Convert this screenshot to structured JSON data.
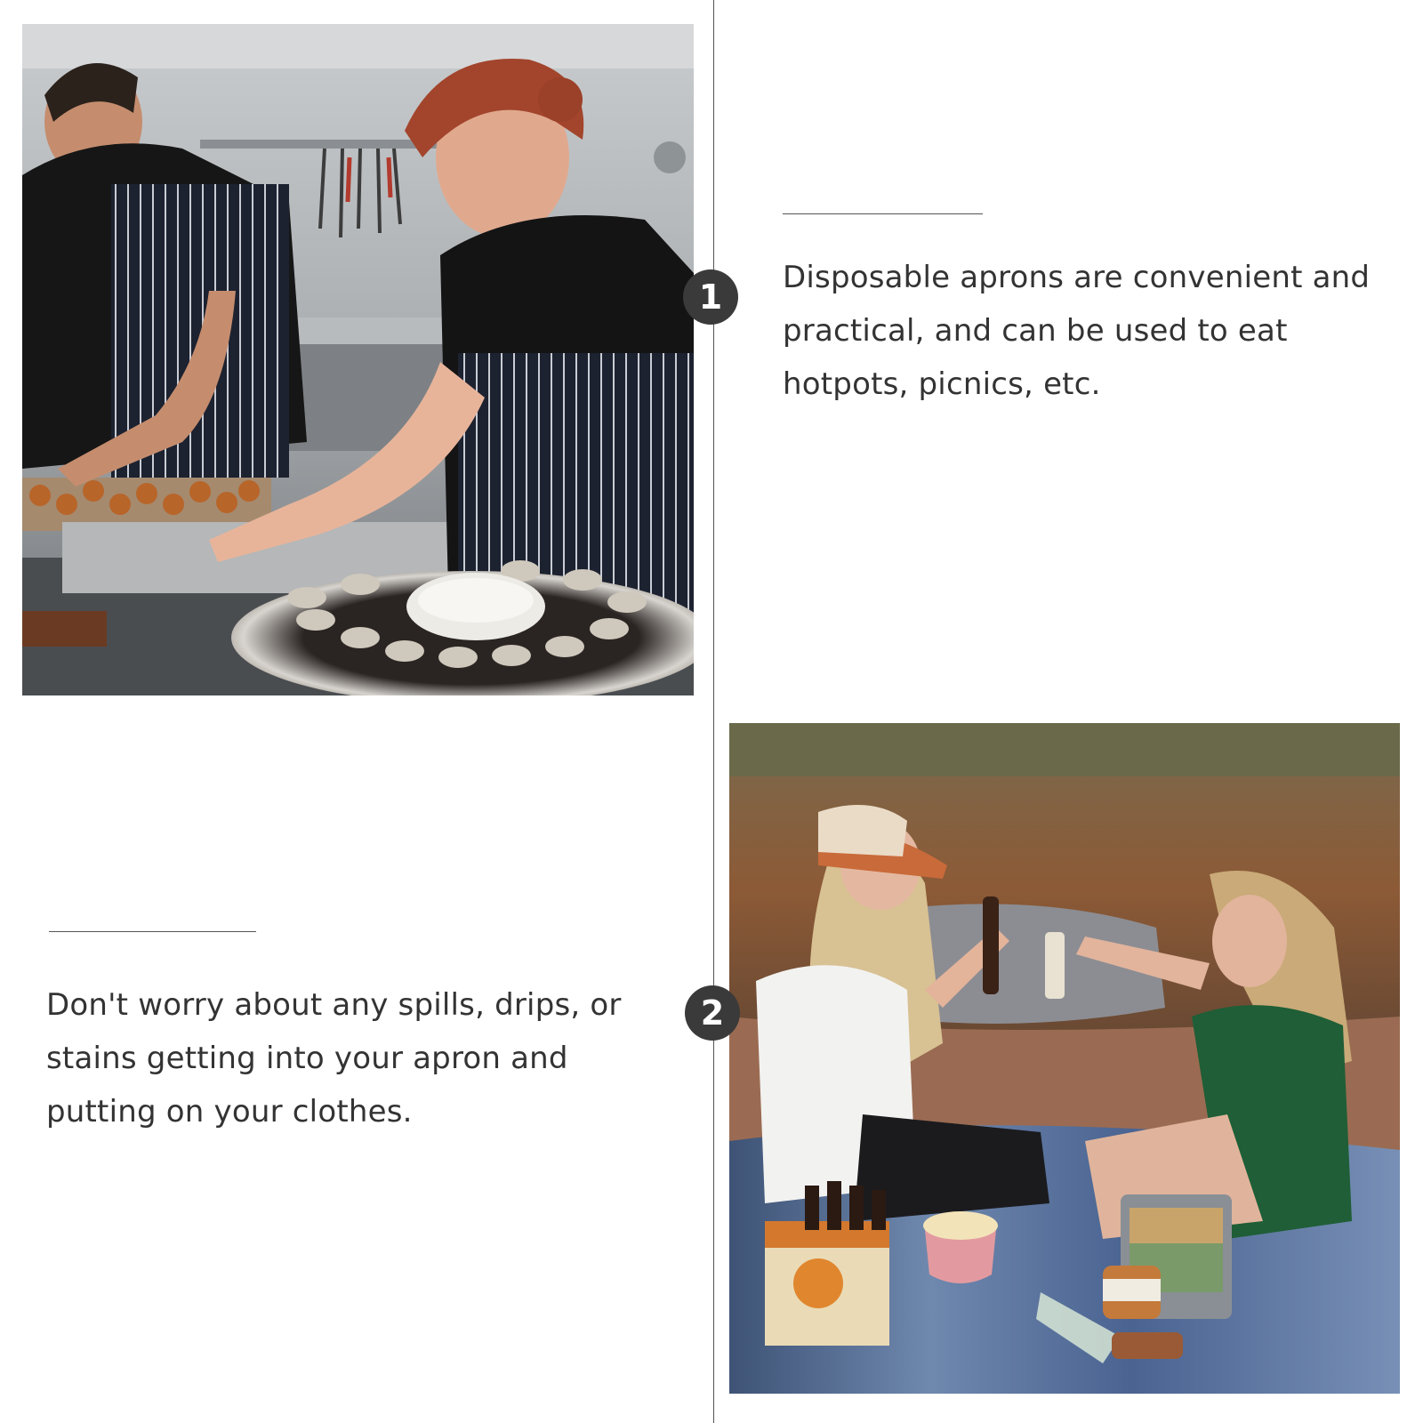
{
  "steps": [
    {
      "number": "1",
      "caption": "Disposable aprons are convenient and practical, and can be used to eat hotpots, picnics, etc."
    },
    {
      "number": "2",
      "caption": "Don't worry about any spills, drips, or stains getting into your apron and putting on your clothes."
    }
  ],
  "photos": [
    {
      "subject": "chefs-in-kitchen-with-oysters"
    },
    {
      "subject": "women-picnic-by-lake"
    }
  ],
  "colors": {
    "background": "#ffffff",
    "text": "#333333",
    "badge": "#3a3a3a",
    "rule": "#555555"
  }
}
